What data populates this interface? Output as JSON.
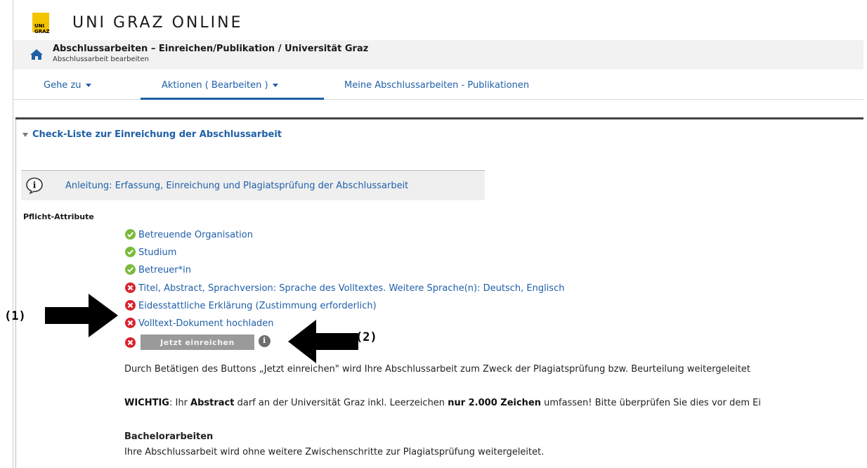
{
  "app": {
    "title": "UNI GRAZ ONLINE",
    "logo_text": "UNI GRAZ"
  },
  "breadcrumb": {
    "title": "Abschlussarbeiten – Einreichen/Publikation / Universität Graz",
    "subtitle": "Abschlussarbeit bearbeiten"
  },
  "nav": {
    "items": [
      {
        "label": "Gehe zu",
        "has_caret": true
      },
      {
        "label": "Aktionen ( Bearbeiten )",
        "has_caret": true,
        "active": true
      },
      {
        "label": "Meine Abschlussarbeiten - Publikationen",
        "has_caret": false
      }
    ]
  },
  "section": {
    "title": "Check-Liste zur Einreichung der Abschlussarbeit",
    "info_link": "Anleitung: Erfassung, Einreichung und Plagiatsprüfung der Abschlussarbeit",
    "required_label": "Pflicht-Attribute",
    "attributes": [
      {
        "label": "Betreuende Organisation",
        "status": "ok"
      },
      {
        "label": "Studium",
        "status": "ok"
      },
      {
        "label": "Betreuer*in",
        "status": "ok"
      },
      {
        "label": "Titel, Abstract, Sprachversion: Sprache des Volltextes. Weitere Sprache(n): Deutsch, Englisch",
        "status": "error"
      },
      {
        "label": "Eidesstattliche Erklärung (Zustimmung erforderlich)",
        "status": "error"
      },
      {
        "label": "Volltext-Dokument hochladen",
        "status": "error"
      }
    ],
    "submit_label": "Jetzt einreichen",
    "info_glyph": "i"
  },
  "text": {
    "para1": "Durch Betätigen des Buttons „Jetzt einreichen\" wird Ihre Abschlussarbeit zum Zweck der Plagiatsprüfung bzw. Beurteilung weitergeleitet",
    "wichtig_1": "WICHTIG",
    "wichtig_2": ": Ihr ",
    "wichtig_3": "Abstract",
    "wichtig_4": " darf an der Universität Graz inkl. Leerzeichen ",
    "wichtig_5": "nur 2.000 Zeichen",
    "wichtig_6": " umfassen! Bitte überprüfen Sie dies vor dem Ei",
    "bachelor_heading": "Bachelorarbeiten",
    "bachelor_text": "Ihre Abschlussarbeit wird ohne weitere Zwischenschritte zur Plagiatsprüfung weitergeleitet."
  },
  "annotations": {
    "label1": "(1)",
    "label2": "(2)"
  },
  "colors": {
    "link": "#1f5fa8",
    "ok": "#7cb93a",
    "error": "#d9232e",
    "button": "#9a9a9a",
    "logo": "#f5c400"
  }
}
